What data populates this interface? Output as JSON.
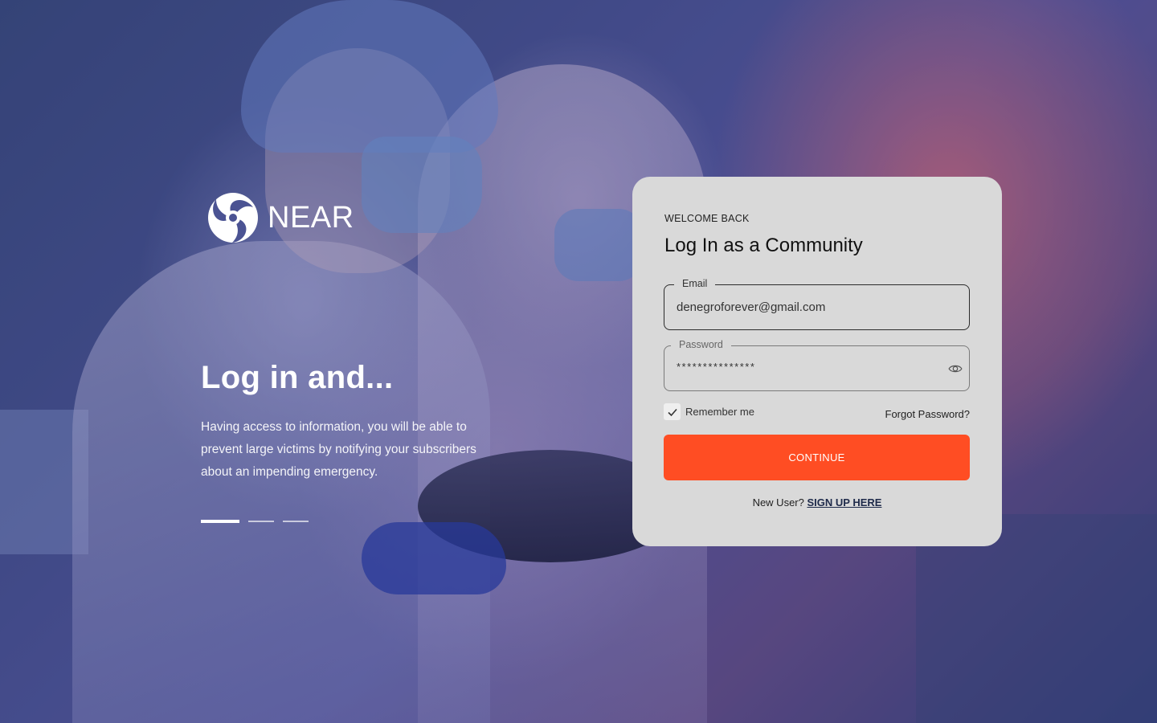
{
  "brand": {
    "name": "NEAR",
    "logo_icon": "near-swirl-logo-icon"
  },
  "hero": {
    "title": "Log in and...",
    "text": "Having access to information, you will be able to prevent large victims by notifying your subscribers about an impending emergency.",
    "carousel": {
      "total": 3,
      "active": 1
    }
  },
  "login": {
    "eyebrow": "WELCOME BACK",
    "title": "Log In as a Community",
    "email": {
      "label": "Email",
      "value": "denegroforever@gmail.com"
    },
    "password": {
      "label": "Password",
      "value": "***************",
      "toggle_icon": "eye-icon"
    },
    "remember_me": {
      "label": "Remember me",
      "checked": true
    },
    "forgot_password": "Forgot Password?",
    "continue_label": "CONTINUE",
    "new_user_text": "New User?",
    "signup_label": "SIGN UP HERE"
  },
  "colors": {
    "accent": "#ff4d23",
    "card_background": "#d9d9d9",
    "link": "#1e2a4a"
  }
}
